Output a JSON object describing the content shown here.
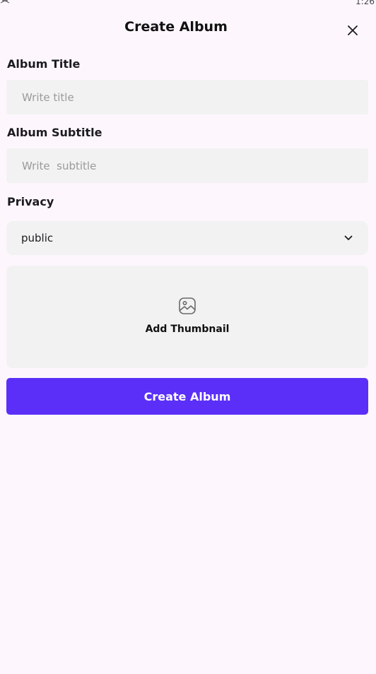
{
  "status_bar": {
    "left_icon": "signal-icon",
    "time": "1:26"
  },
  "header": {
    "title": "Create Album",
    "close_icon": "close-icon"
  },
  "form": {
    "title_label": "Album Title",
    "title_placeholder": "Write title",
    "title_value": "",
    "subtitle_label": "Album Subtitle",
    "subtitle_placeholder": "Write  subtitle",
    "subtitle_value": "",
    "privacy_label": "Privacy",
    "privacy_value": "public",
    "privacy_icon": "chevron-down-icon",
    "thumbnail_label": "Add Thumbnail",
    "thumbnail_icon": "image-icon",
    "submit_label": "Create Album"
  },
  "colors": {
    "background": "#fdf7fd",
    "field_background": "#f2f2f2",
    "primary": "#5b2ff8",
    "placeholder": "#9a9a9a"
  }
}
